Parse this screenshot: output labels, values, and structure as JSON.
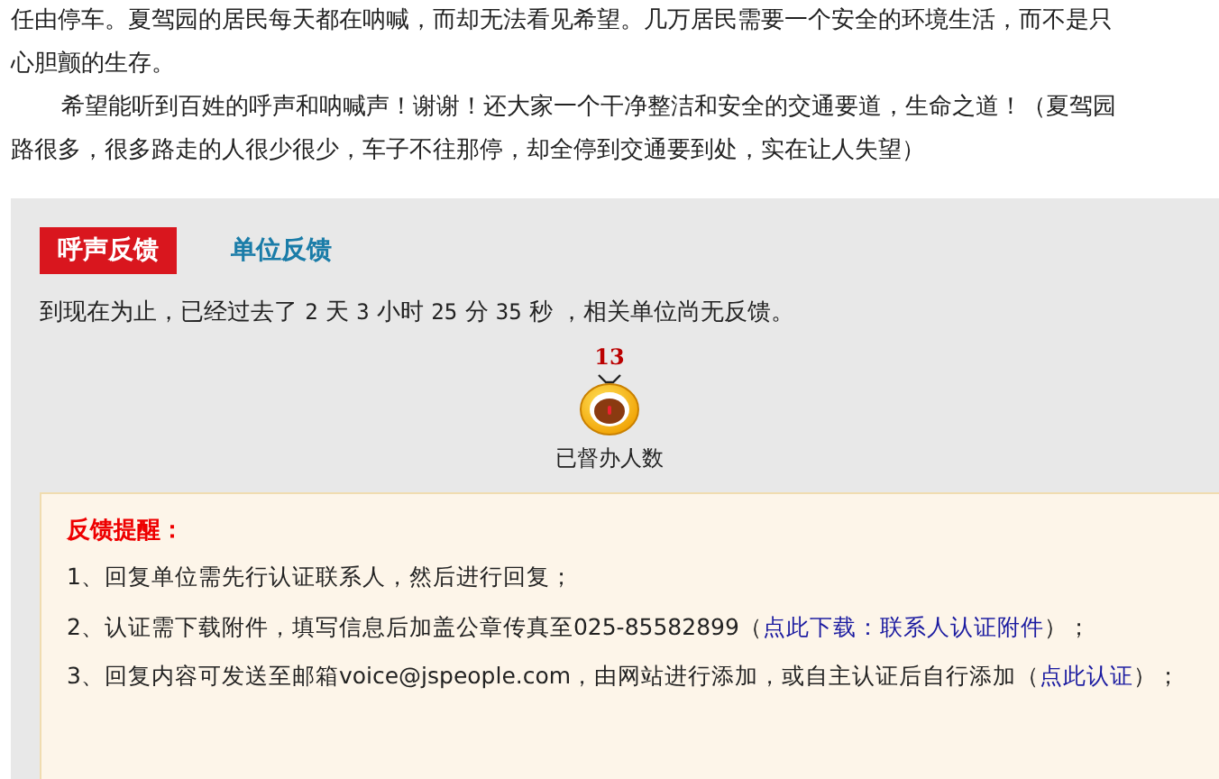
{
  "article": {
    "paragraphs": [
      {
        "lines": [
          "任由停车。夏驾园的居民每天都在呐喊，而却无法看见希望。几万居民需要一个安全的环境生活，而不是只",
          "心胆颤的生存。"
        ]
      },
      {
        "lines": [
          "希望能听到百姓的呼声和呐喊声！谢谢！还大家一个干净整洁和安全的交通要道，生命之道！（夏驾园",
          "路很多，很多路走的人很少很少，车子不往那停，却全停到交通要到处，实在让人失望）"
        ]
      }
    ]
  },
  "feedback": {
    "tabs": [
      {
        "label": "呼声反馈",
        "selected": true
      },
      {
        "label": "单位反馈",
        "selected": false
      }
    ],
    "elapsed": {
      "prefix": "到现在为止，已经过去了",
      "parts": [
        {
          "value": "2",
          "unit": "天"
        },
        {
          "value": "3",
          "unit": "小时"
        },
        {
          "value": "25",
          "unit": "分"
        },
        {
          "value": "35",
          "unit": "秒"
        }
      ],
      "suffix": "，相关单位尚无反馈。"
    },
    "supervise": {
      "count": "13",
      "label": "已督办人数"
    },
    "reminder": {
      "title": "反馈提醒：",
      "items": [
        {
          "text": "1、回复单位需先行认证联系人，然后进行回复；"
        },
        {
          "text": "2、认证需下载附件，填写信息后加盖公章传真至025-85582899（",
          "link": "点此下载：联系人认证附件",
          "after": "）；"
        },
        {
          "text": "3、回复内容可发送至邮箱voice@jspeople.com，由网站进行添加，或自主认证后自行添加（",
          "link": "点此认证",
          "after": "）；"
        }
      ]
    }
  }
}
